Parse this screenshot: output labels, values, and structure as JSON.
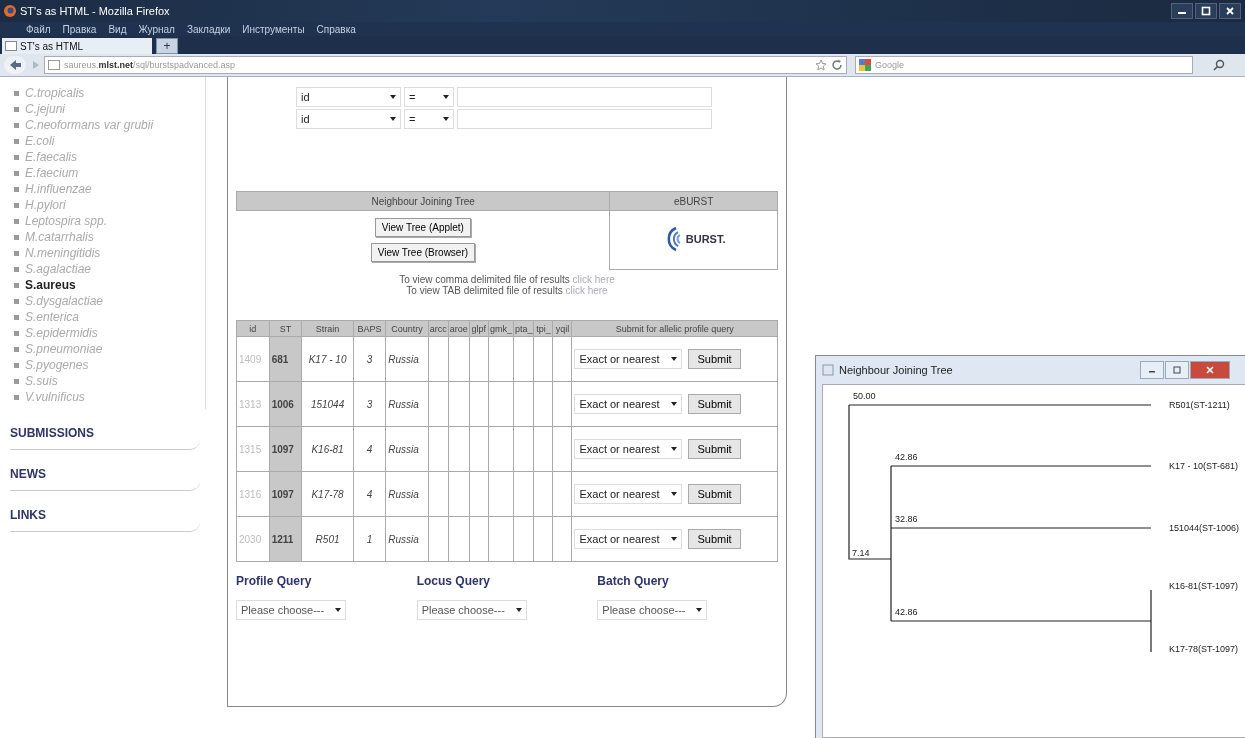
{
  "window": {
    "title": "ST's as HTML - Mozilla Firefox"
  },
  "menu": [
    "Файл",
    "Правка",
    "Вид",
    "Журнал",
    "Закладки",
    "Инструменты",
    "Справка"
  ],
  "tabs": [
    {
      "label": "ST's as HTML",
      "selected": true
    }
  ],
  "new_tab": "+",
  "address": {
    "host": "saureus.",
    "domain": "mlst.net",
    "path": "/sql/burstspadvanced.asp"
  },
  "search": {
    "placeholder": "Google"
  },
  "sidebar": {
    "species": [
      {
        "label": "C.tropicalis",
        "selected": false
      },
      {
        "label": "C.jejuni",
        "selected": false
      },
      {
        "label": "C.neoformans var grubii",
        "selected": false
      },
      {
        "label": "E.coli",
        "selected": false
      },
      {
        "label": "E.faecalis",
        "selected": false
      },
      {
        "label": "E.faecium",
        "selected": false
      },
      {
        "label": "H.influenzae",
        "selected": false
      },
      {
        "label": "H.pylori",
        "selected": false
      },
      {
        "label": "Leptospira spp.",
        "selected": false
      },
      {
        "label": "M.catarrhalis",
        "selected": false
      },
      {
        "label": "N.meningitidis",
        "selected": false
      },
      {
        "label": "S.agalactiae",
        "selected": false
      },
      {
        "label": "S.aureus",
        "selected": true
      },
      {
        "label": "S.dysgalactiae",
        "selected": false
      },
      {
        "label": "S.enterica",
        "selected": false
      },
      {
        "label": "S.epidermidis",
        "selected": false
      },
      {
        "label": "S.pneumoniae",
        "selected": false
      },
      {
        "label": "S.pyogenes",
        "selected": false
      },
      {
        "label": "S.suis",
        "selected": false
      },
      {
        "label": "V.vulnificus",
        "selected": false
      }
    ],
    "sections": [
      "SUBMISSIONS",
      "NEWS",
      "LINKS"
    ]
  },
  "query_rows": [
    {
      "field": "id",
      "operator": "="
    },
    {
      "field": "id",
      "operator": "="
    }
  ],
  "tools": {
    "nj_heading": "Neighbour Joining Tree",
    "eburst_heading": "eBURST",
    "buttons": [
      "View Tree (Applet)",
      "View Tree (Browser)"
    ],
    "eburst_logo": "BURST."
  },
  "downloads": [
    {
      "text": "To view comma delimited file of results ",
      "link": "click here"
    },
    {
      "text": "To view TAB delimited file of results ",
      "link": "click here"
    }
  ],
  "results": {
    "columns": [
      "id",
      "ST",
      "Strain",
      "BAPS",
      "Country",
      "arcc",
      "aroe",
      "glpf",
      "gmk_",
      "pta_",
      "tpi_",
      "yqil",
      "Submit for allelic profile query"
    ],
    "rows": [
      {
        "id": "1409",
        "st": "681",
        "strain": "K17 - 10",
        "baps": "3",
        "country": "Russia",
        "match": "Exact or nearest",
        "submit": "Submit"
      },
      {
        "id": "1313",
        "st": "1006",
        "strain": "151044",
        "baps": "3",
        "country": "Russia",
        "match": "Exact or nearest",
        "submit": "Submit"
      },
      {
        "id": "1315",
        "st": "1097",
        "strain": "K16-81",
        "baps": "4",
        "country": "Russia",
        "match": "Exact or nearest",
        "submit": "Submit"
      },
      {
        "id": "1316",
        "st": "1097",
        "strain": "K17-78",
        "baps": "4",
        "country": "Russia",
        "match": "Exact or nearest",
        "submit": "Submit"
      },
      {
        "id": "2030",
        "st": "1211",
        "strain": "R501",
        "baps": "1",
        "country": "Russia",
        "match": "Exact or nearest",
        "submit": "Submit"
      }
    ]
  },
  "queries": [
    {
      "title": "Profile Query",
      "select": "Please choose---"
    },
    {
      "title": "Locus Query",
      "select": "Please choose---"
    },
    {
      "title": "Batch Query",
      "select": "Please choose---"
    }
  ],
  "tree_window": {
    "title": "Neighbour Joining Tree",
    "branch_lengths": [
      "50.00",
      "42.86",
      "32.86",
      "7.14",
      "42.86"
    ],
    "leaves": [
      "R501(ST-1211)",
      "K17 - 10(ST-681)",
      "151044(ST-1006)",
      "K16-81(ST-1097)",
      "K17-78(ST-1097)"
    ]
  }
}
